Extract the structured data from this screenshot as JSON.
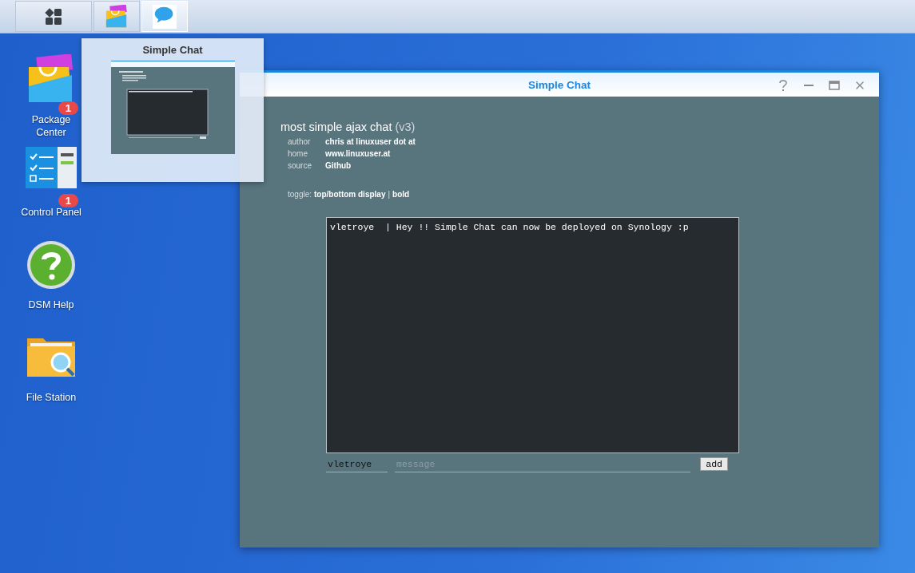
{
  "taskbar": {
    "items": [
      {
        "kind": "menu",
        "selected": false
      },
      {
        "kind": "package",
        "selected": false
      },
      {
        "kind": "chat",
        "selected": true
      }
    ]
  },
  "desktop_icons": [
    {
      "kind": "package",
      "label": "Package Center",
      "badge": "1"
    },
    {
      "kind": "control",
      "label": "Control Panel",
      "badge": "1"
    },
    {
      "kind": "help",
      "label": "DSM Help"
    },
    {
      "kind": "folder",
      "label": "File Station"
    }
  ],
  "preview": {
    "title": "Simple Chat"
  },
  "window": {
    "title": "Simple Chat",
    "heading": "most simple ajax chat",
    "version": "(v3)",
    "info": [
      {
        "label": "author",
        "value": "chris at linuxuser dot at"
      },
      {
        "label": "home",
        "value": "www.linuxuser.at"
      },
      {
        "label": "source",
        "value": "Github"
      }
    ],
    "toggle": {
      "label": "toggle:",
      "links": [
        "top/bottom display",
        "bold"
      ],
      "separator": "|"
    },
    "messages": [
      "vletroye  | Hey !! Simple Chat can now be deployed on Synology :p"
    ],
    "name_field": {
      "value": "vletroye"
    },
    "message_field": {
      "placeholder": "message"
    },
    "add_button": "add"
  }
}
